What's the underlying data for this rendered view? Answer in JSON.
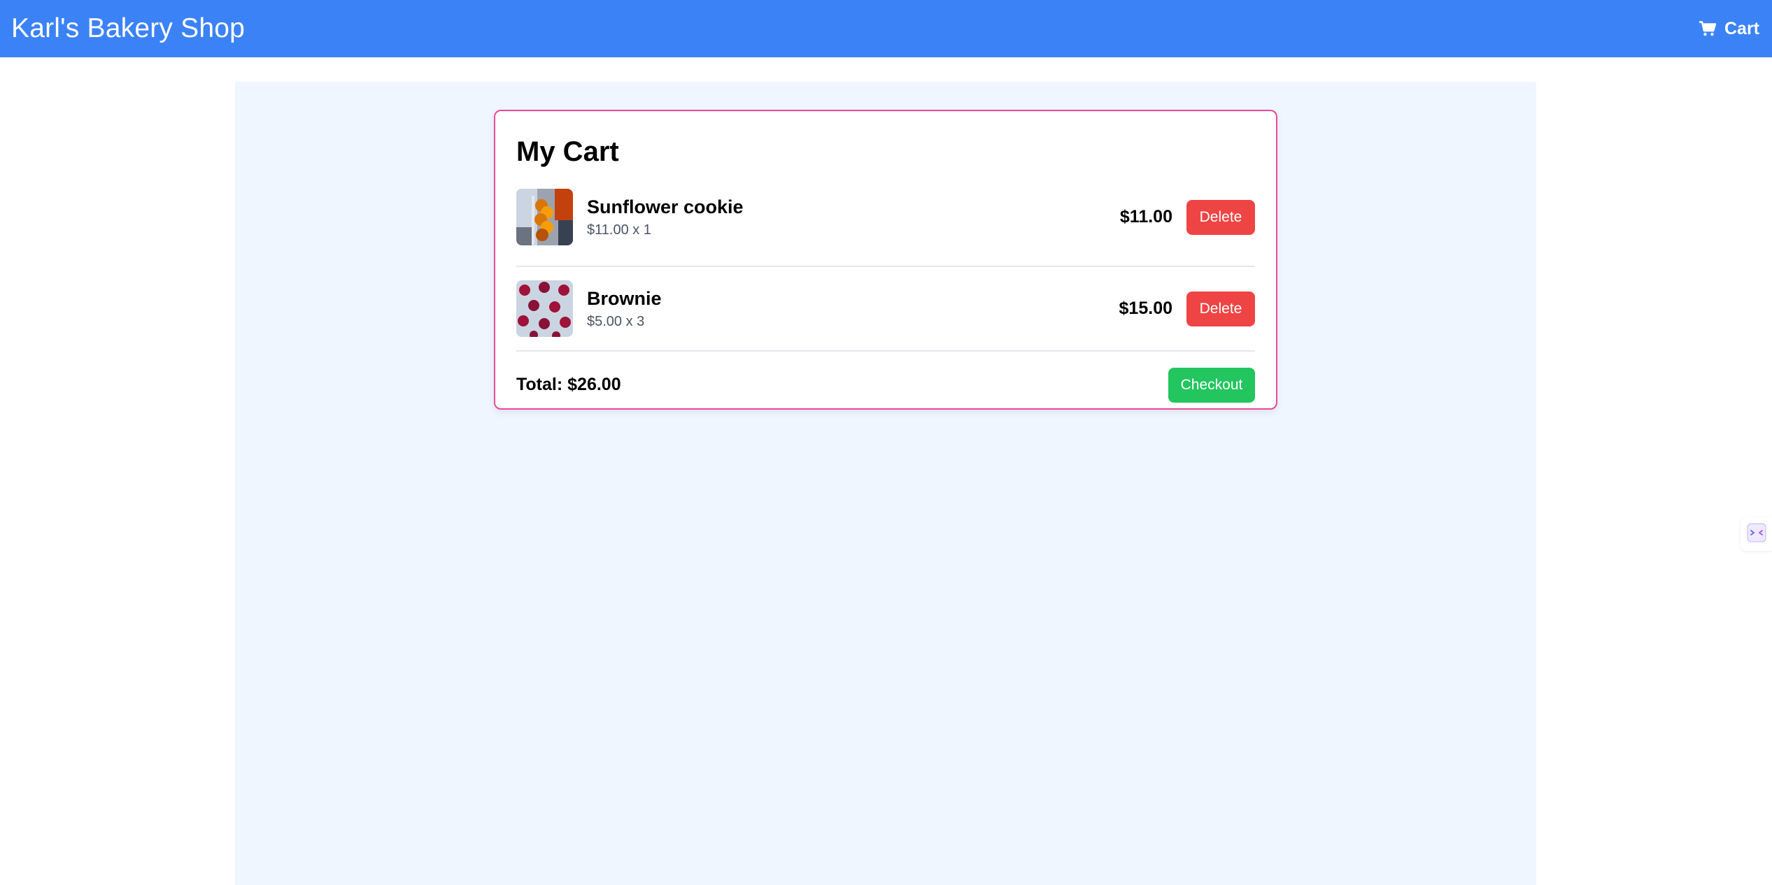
{
  "header": {
    "brand": "Karl's Bakery Shop",
    "cart_label": "Cart",
    "cart_icon": "shopping-cart-icon",
    "background": "#3b82f6"
  },
  "cart": {
    "title": "My Cart",
    "items": [
      {
        "name": "Sunflower cookie",
        "unit_qty": "$11.00 x 1",
        "line_total": "$11.00",
        "delete_label": "Delete",
        "image": "sunflower-cookie-photo"
      },
      {
        "name": "Brownie",
        "unit_qty": "$5.00 x 3",
        "line_total": "$15.00",
        "delete_label": "Delete",
        "image": "brownie-photo"
      }
    ],
    "total": "Total: $26.00",
    "checkout_label": "Checkout"
  },
  "colors": {
    "delete": "#ef4444",
    "checkout": "#22c55e",
    "card_border": "#ec4899",
    "page_panel": "#eff6ff"
  },
  "side_widget": {
    "icon": "translate-widget-icon"
  }
}
